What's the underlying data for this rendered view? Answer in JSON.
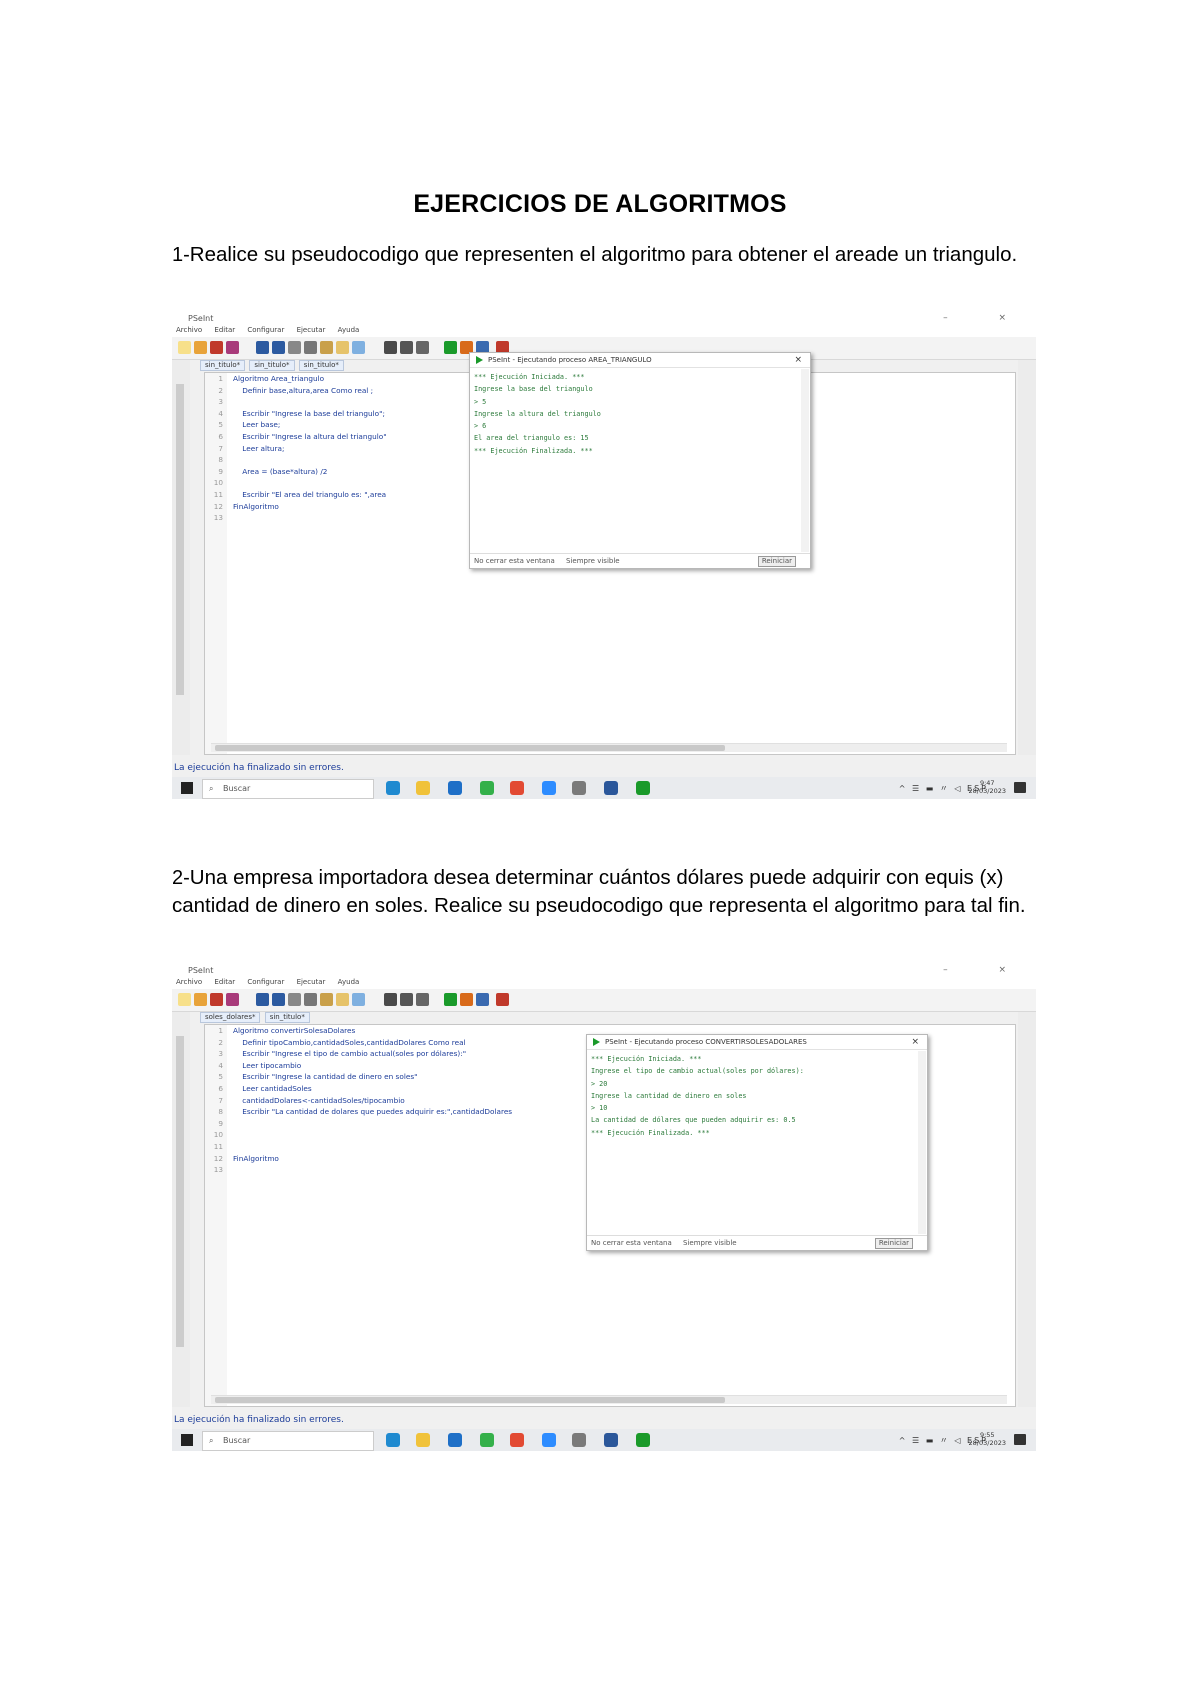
{
  "document": {
    "title": "EJERCICIOS DE ALGORITMOS",
    "q1_num": "1-",
    "q1_text": "Realice su pseudocodigo que representen el algoritmo para obtener el areade un triangulo.",
    "q2_num": "2-",
    "q2_text": "Una empresa importadora desea determinar cuántos dólares puede adquirir con equis (x) cantidad de dinero en soles. Realice su pseudocodigo que representa el algoritmo para tal fin."
  },
  "screenshot1": {
    "window_title": "PSeInt",
    "menu": [
      "Archivo",
      "Editar",
      "Configurar",
      "Ejecutar",
      "Ayuda"
    ],
    "tabs": [
      "sin_titulo*",
      "sin_titulo*",
      "sin_titulo*"
    ],
    "code_lines": [
      "Algoritmo Area_triangulo",
      "    Definir base,altura,area Como real ;",
      "",
      "    Escribir \"Ingrese la base del triangulo\";",
      "    Leer base;",
      "    Escribir \"Ingrese la altura del triangulo\"",
      "    Leer altura;",
      "",
      "    Area = (base*altura) /2",
      "",
      "    Escribir \"El area del triangulo es: \",area",
      "FinAlgoritmo",
      ""
    ],
    "console_title": "PSeInt - Ejecutando proceso AREA_TRIANGULO",
    "console_lines": [
      "*** Ejecución Iniciada. ***",
      "Ingrese la base del triangulo",
      "> 5",
      "Ingrese la altura del triangulo",
      "> 6",
      "El area del triangulo es: 15",
      "*** Ejecución Finalizada. ***"
    ],
    "console_opt1": "No cerrar esta ventana",
    "console_opt2": "Siempre visible",
    "console_button": "Reiniciar",
    "status": "La ejecución ha finalizado sin errores.",
    "search": "Buscar",
    "tray": "^ ☰ ▬ 〃 ◁ ESP",
    "time": "9:47",
    "date": "28/03/2023"
  },
  "screenshot2": {
    "window_title": "PSeInt",
    "menu": [
      "Archivo",
      "Editar",
      "Configurar",
      "Ejecutar",
      "Ayuda"
    ],
    "tabs": [
      "soles_dolares*",
      "sin_titulo*"
    ],
    "code_lines": [
      "Algoritmo convertirSolesaDolares",
      "    Definir tipoCambio,cantidadSoles,cantidadDolares Como real",
      "    Escribir \"Ingrese el tipo de cambio actual(soles por dólares):\"",
      "    Leer tipocambio",
      "    Escribir \"Ingrese la cantidad de dinero en soles\"",
      "    Leer cantidadSoles",
      "    cantidadDolares<-cantidadSoles/tipocambio",
      "    Escribir \"La cantidad de dolares que puedes adquirir es:\",cantidadDolares",
      "",
      "",
      "",
      "FinAlgoritmo",
      ""
    ],
    "console_title": "PSeInt - Ejecutando proceso CONVERTIRSOLESADOLARES",
    "console_lines": [
      "*** Ejecución Iniciada. ***",
      "Ingrese el tipo de cambio actual(soles por dólares):",
      "> 20",
      "Ingrese la cantidad de dinero en soles",
      "> 10",
      "La cantidad de dólares que pueden adquirir es: 0.5",
      "*** Ejecución Finalizada. ***"
    ],
    "console_opt1": "No cerrar esta ventana",
    "console_opt2": "Siempre visible",
    "console_button": "Reiniciar",
    "status": "La ejecución ha finalizado sin errores.",
    "search": "Buscar",
    "tray": "^ ☰ ▬ 〃 ◁ ESP",
    "time": "9:55",
    "date": "28/03/2023"
  }
}
